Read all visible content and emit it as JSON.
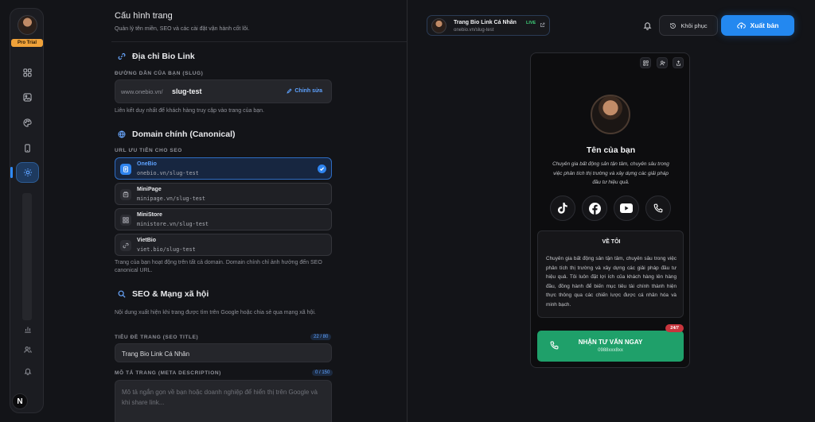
{
  "rail": {
    "badge": "Pro Trial",
    "items": [
      {
        "icon": "grid-icon"
      },
      {
        "icon": "image-icon"
      },
      {
        "icon": "palette-icon"
      },
      {
        "icon": "phone-icon"
      },
      {
        "icon": "settings-icon",
        "active": true
      },
      {
        "icon": "chart-icon"
      },
      {
        "icon": "users-icon"
      },
      {
        "icon": "bell-icon"
      }
    ],
    "bottom_badge": "N"
  },
  "page": {
    "title": "Cấu hình trang",
    "subtitle": "Quản lý tên miền, SEO và các cài đặt vận hành cốt lõi."
  },
  "bio_link": {
    "heading": "Địa chỉ Bio Link",
    "label": "ĐƯỜNG DẪN CỦA BẠN (SLUG)",
    "prefix": "www.onebio.vn/",
    "slug": "slug-test",
    "edit_label": "Chỉnh sửa",
    "hint": "Liên kết duy nhất để khách hàng truy cập vào trang của bạn."
  },
  "domain": {
    "heading": "Domain chính (Canonical)",
    "label": "URL ƯU TIÊN CHO SEO",
    "options": [
      {
        "name": "OneBio",
        "url": "onebio.vn/slug-test",
        "selected": true
      },
      {
        "name": "MiniPage",
        "url": "minipage.vn/slug-test",
        "selected": false
      },
      {
        "name": "MiniStore",
        "url": "ministore.vn/slug-test",
        "selected": false
      },
      {
        "name": "VietBio",
        "url": "viet.bio/slug-test",
        "selected": false
      }
    ],
    "hint": "Trang của bạn hoạt động trên tất cả domain. Domain chính chỉ ảnh hưởng đến SEO canonical URL."
  },
  "seo": {
    "heading": "SEO & Mạng xã hội",
    "hint": "Nội dung xuất hiện khi trang được tìm trên Google hoặc chia sẻ qua mạng xã hội.",
    "title_label": "TIÊU ĐỀ TRANG (SEO TITLE)",
    "title_count": "22 / 80",
    "title_value": "Trang Bio Link Cá Nhân",
    "desc_label": "MÔ TẢ TRANG (META DESCRIPTION)",
    "desc_count": "0 / 150",
    "desc_placeholder": "Mô tả ngắn gọn về bạn hoặc doanh nghiệp để hiển thị trên Google và khi share link..."
  },
  "topbar": {
    "page_name": "Trang Bio Link Cá Nhân",
    "live": "LIVE",
    "page_url": "onebio.vn/slug-test",
    "restore_label": "Khôi phục",
    "publish_label": "Xuất bản"
  },
  "preview": {
    "name": "Tên của bạn",
    "bio": "Chuyên gia bất động sản tận tâm, chuyên sâu trong việc phân tích thị trường và xây dựng các giải pháp đầu tư hiệu quả.",
    "socials": [
      "tiktok-icon",
      "facebook-icon",
      "youtube-icon",
      "phone-icon"
    ],
    "about_heading": "VỀ TÔI",
    "about_text": "Chuyên gia bất động sản tận tâm, chuyên sâu trong việc phân tích thị trường và xây dựng các giải pháp đầu tư hiệu quả. Tôi luôn đặt lợi ích của khách hàng lên hàng đầu, đồng hành để biến mục tiêu tài chính thành hiện thực thông qua các chiến lược được cá nhân hóa và minh bạch.",
    "cta_tag": "24/7",
    "cta_title": "NHẬN TƯ VẤN NGAY",
    "cta_phone": "0988xxx8xx"
  },
  "colors": {
    "accent": "#2388f0",
    "cta": "#1fa06a",
    "pro": "#f0a23a",
    "live": "#3ed07a"
  }
}
